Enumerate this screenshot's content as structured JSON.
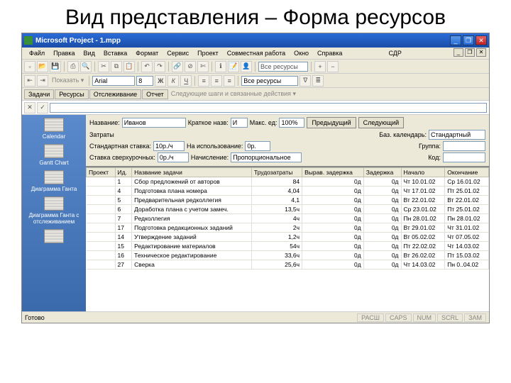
{
  "slide_title": "Вид представления – Форма ресурсов",
  "titlebar": {
    "title": "Microsoft Project - 1.mpp"
  },
  "menu": [
    "Файл",
    "Правка",
    "Вид",
    "Вставка",
    "Формат",
    "Сервис",
    "Проект",
    "Совместная работа",
    "Окно",
    "Справка"
  ],
  "menu_right": "СДР",
  "toolbar2": {
    "show_label": "Показать ▾",
    "font": "Arial",
    "size": "8",
    "resources_label": "Все ресурсы"
  },
  "tabs": [
    "Задачи",
    "Ресурсы",
    "Отслеживание",
    "Отчет"
  ],
  "tabs_hint": "Следующие шаги и связанные действия ▾",
  "sidebar": [
    {
      "label": "Calendar"
    },
    {
      "label": "Gantt Chart"
    },
    {
      "label": "Диаграмма Ганта"
    },
    {
      "label": "Диаграмма Ганта с отслеживанием"
    }
  ],
  "form": {
    "name_label": "Название:",
    "name_value": "Иванов",
    "short_label": "Краткое назв:",
    "short_value": "И",
    "max_label": "Макс. ед:",
    "max_value": "100%",
    "prev_btn": "Предыдущий",
    "next_btn": "Следующий",
    "costs_label": "Затраты",
    "std_label": "Стандартная ставка:",
    "std_value": "10р./ч",
    "use_label": "На использование:",
    "use_value": "0р.",
    "cal_label": "Баз. календарь:",
    "cal_value": "Стандартный",
    "ovt_label": "Ставка сверхурочных:",
    "ovt_value": "0р./ч",
    "acc_label": "Начисление:",
    "acc_value": "Пропорциональное",
    "group_label": "Группа:",
    "code_label": "Код:"
  },
  "columns": [
    "Проект",
    "Ид.",
    "Название задачи",
    "Трудозатраты",
    "Вырав. задержка",
    "Задержка",
    "Начало",
    "Окончание"
  ],
  "rows": [
    {
      "id": "1",
      "name": "Сбор предложений от авторов",
      "work": "84",
      "lev": "0д",
      "del": "0д",
      "start": "Чт 10.01.02",
      "end": "Ср 16.01.02"
    },
    {
      "id": "4",
      "name": "Подготовка плана номера",
      "work": "4,04",
      "lev": "0д",
      "del": "0д",
      "start": "Чт 17.01.02",
      "end": "Пт 25.01.02"
    },
    {
      "id": "5",
      "name": "Предварительная редколлегия",
      "work": "4,1",
      "lev": "0д",
      "del": "0д",
      "start": "Вт 22.01.02",
      "end": "Вт 22.01.02"
    },
    {
      "id": "6",
      "name": "Доработка плана с учетом замеч.",
      "work": "13,5ч",
      "lev": "0д",
      "del": "0д",
      "start": "Ср 23.01.02",
      "end": "Пт 25.01.02"
    },
    {
      "id": "7",
      "name": "Редколлегия",
      "work": "4ч",
      "lev": "0д",
      "del": "0д",
      "start": "Пн 28.01.02",
      "end": "Пн 28.01.02"
    },
    {
      "id": "17",
      "name": "Подготовка редакционных заданий",
      "work": "2ч",
      "lev": "0д",
      "del": "0д",
      "start": "Вт 29.01.02",
      "end": "Чт 31.01.02"
    },
    {
      "id": "14",
      "name": "Утверждение заданий",
      "work": "1,2ч",
      "lev": "0д",
      "del": "0д",
      "start": "Вт 05.02.02",
      "end": "Чт 07.05.02"
    },
    {
      "id": "15",
      "name": "Редактирование материалов",
      "work": "54ч",
      "lev": "0д",
      "del": "0д",
      "start": "Пт 22.02.02",
      "end": "Чт 14.03.02"
    },
    {
      "id": "16",
      "name": "Техническое редактирование",
      "work": "33,6ч",
      "lev": "0д",
      "del": "0д",
      "start": "Вт 26.02.02",
      "end": "Пт 15.03.02"
    },
    {
      "id": "27",
      "name": "Сверка",
      "work": "25,6ч",
      "lev": "0д",
      "del": "0д",
      "start": "Чт 14.03.02",
      "end": "Пн 0..04.02"
    }
  ],
  "status": {
    "ready": "Готово",
    "cells": [
      "РАСШ",
      "CAPS",
      "NUM",
      "SCRL",
      "ЗАМ"
    ]
  }
}
